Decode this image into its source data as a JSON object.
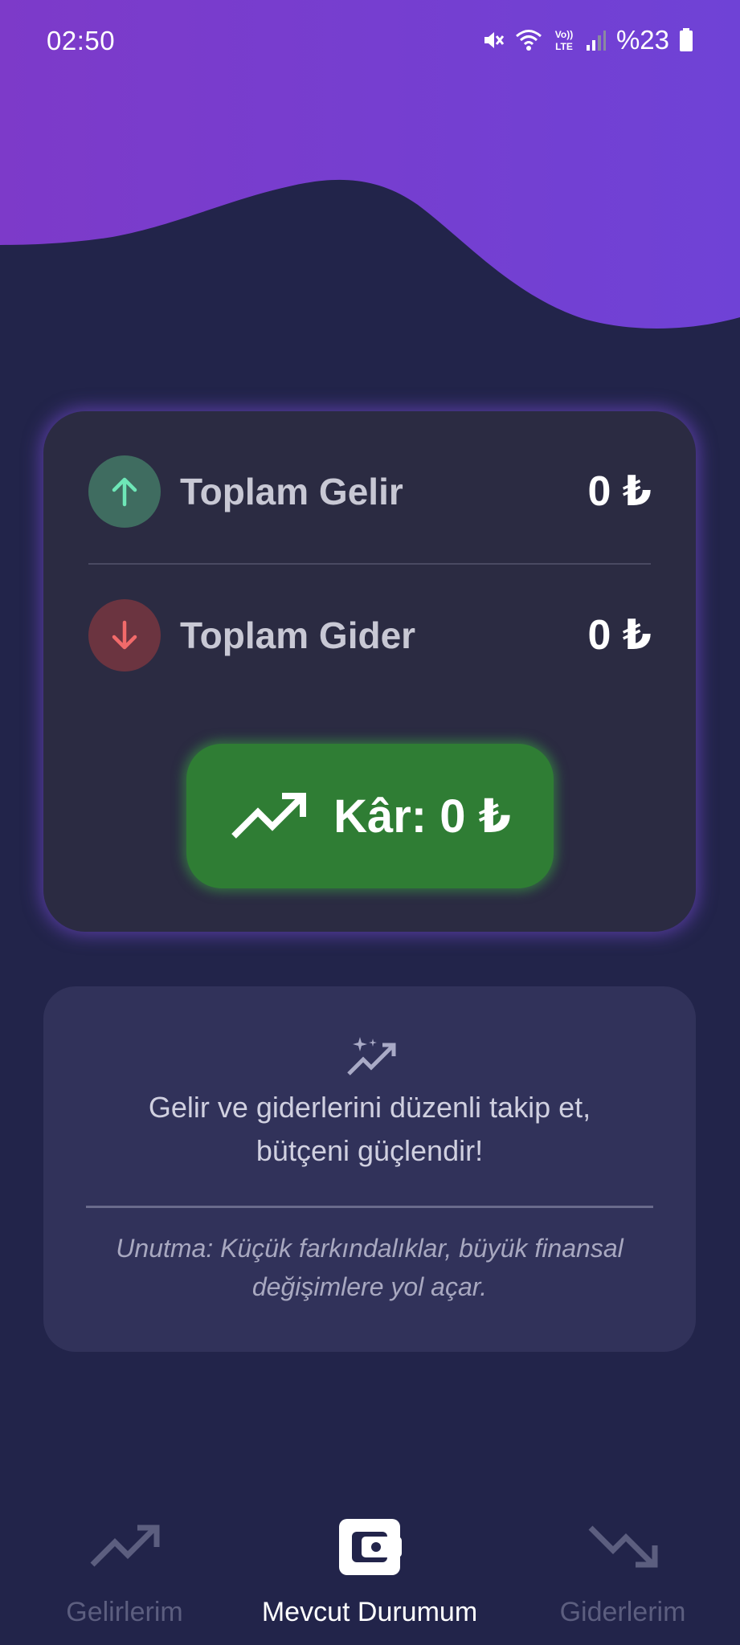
{
  "status_bar": {
    "time": "02:50",
    "volte_label": "Vo)) LTE",
    "battery": "%23",
    "icons": [
      "mute-icon",
      "wifi-icon",
      "volte-icon",
      "signal-icon",
      "battery-icon"
    ]
  },
  "summary": {
    "income_label": "Toplam Gelir",
    "income_value": "0 ₺",
    "expense_label": "Toplam Gider",
    "expense_value": "0 ₺",
    "profit_label": "Kâr: 0 ₺"
  },
  "tip": {
    "message_line1": "Gelir ve giderlerini düzenli takip et,",
    "message_line2": "bütçeni güçlendir!",
    "note_line1": "Unutma: Küçük farkındalıklar, büyük finansal",
    "note_line2": "değişimlere yol açar."
  },
  "nav": {
    "income": "Gelirlerim",
    "current": "Mevcut Durumum",
    "expense": "Giderlerim",
    "active": "current"
  },
  "colors": {
    "background": "#22244a",
    "header_purple": "#7b3fd0",
    "card": "#2b2b42",
    "profit_green": "#2f7d34",
    "income_green": "#6ee7b7",
    "expense_red": "#f26a6a"
  }
}
